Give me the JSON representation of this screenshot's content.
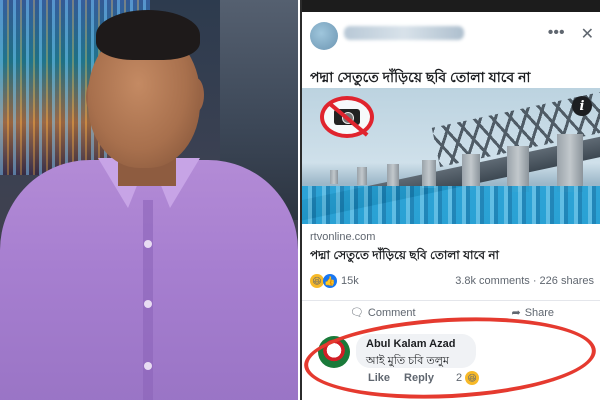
{
  "post": {
    "menu_icon": "more-dots-icon",
    "close_icon": "close-icon",
    "text": "পদ্মা সেতুতে দাঁড়িয়ে ছবি তোলা যাবে না",
    "info_icon_glyph": "i"
  },
  "link": {
    "source": "rtvonline.com",
    "title": "পদ্মা সেতুতে দাঁড়িয়ে ছবি তোলা যাবে না"
  },
  "stats": {
    "reactions_count": "15k",
    "comments_shares": "3.8k comments · 226 shares"
  },
  "actions": {
    "comment": "Comment",
    "share": "Share"
  },
  "comment": {
    "author": "Abul Kalam Azad",
    "text": "আই মুতি চবি তলুম",
    "like": "Like",
    "reply": "Reply",
    "reaction_count": "2"
  },
  "colors": {
    "highlight_circle": "#e53a2f",
    "facebook_blue": "#1877f2",
    "no_photo_red": "#e0242e"
  }
}
